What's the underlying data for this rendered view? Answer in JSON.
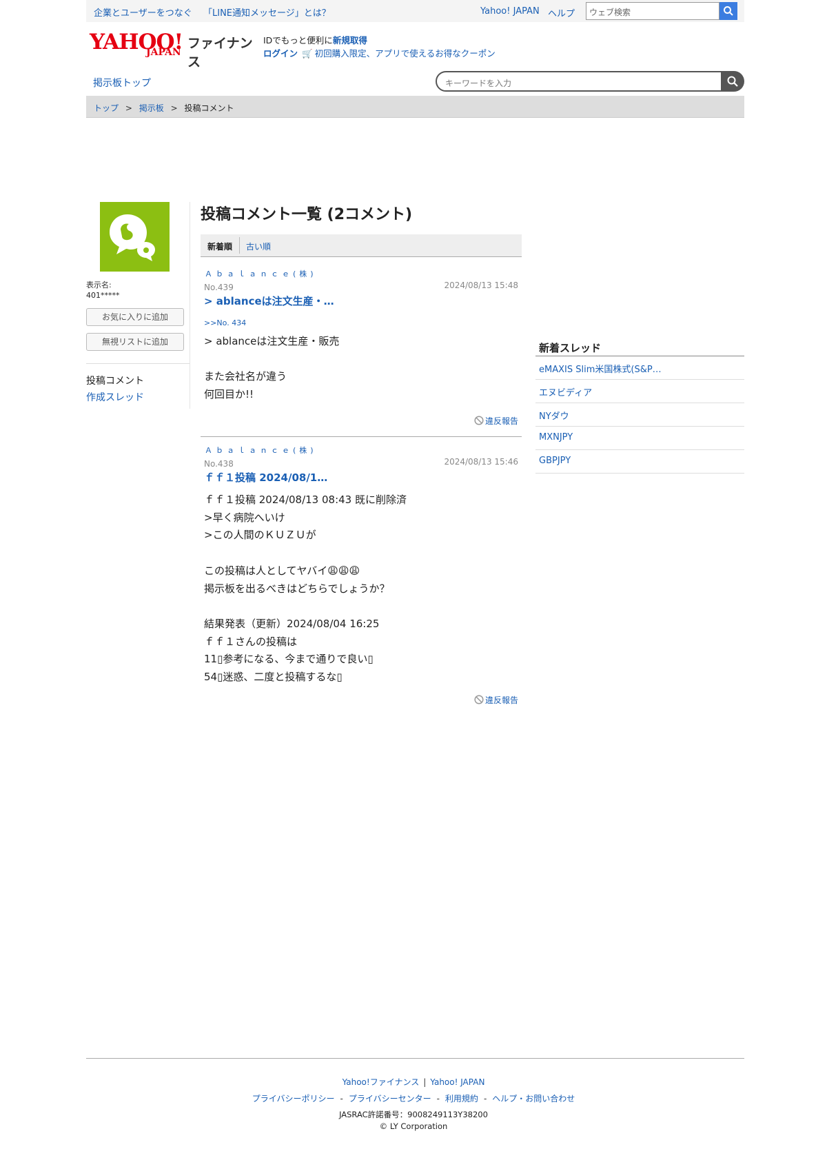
{
  "topbar": {
    "link1": "企業とユーザーをつなぐ",
    "link2": "「LINE通知メッセージ」とは？",
    "yahoo_japan": "Yahoo! JAPAN",
    "help": "ヘルプ",
    "web_search_placeholder": "ウェブ検索"
  },
  "header": {
    "logo_yahoo": "YAHOO!",
    "logo_japan": "JAPAN",
    "logo_finance": "ファイナンス",
    "promo_text": "IDでもっと便利に",
    "promo_signup": "新規取得",
    "login": "ログイン",
    "coupon": "初回購入限定、アプリで使えるお得なクーポン"
  },
  "nav": {
    "board_top": "掲示板トップ",
    "keyword_placeholder": "キーワードを入力"
  },
  "breadcrumb": [
    "トップ",
    "掲示板",
    "投稿コメント"
  ],
  "breadcrumb_sep": ">",
  "profile": {
    "display_name_label": "表示名:",
    "display_name": "401*****",
    "favorite_button": "お気に入りに追加",
    "ignore_button": "無視リストに追加",
    "nav_comments": "投稿コメント",
    "nav_threads": "作成スレッド"
  },
  "main": {
    "heading": "投稿コメント一覧 (2コメント)",
    "sort_newest": "新着順",
    "sort_oldest": "古い順",
    "report_label": "違反報告",
    "posts": [
      {
        "company": "Ａｂａｌａｎｃｅ(株)",
        "number": "No.439",
        "datetime": "2024/08/13 15:48",
        "title": "> ablanceは注文生産・…",
        "reply_to": ">>No. 434",
        "body": "> ablanceは注文生産・販売\n\nまた会社名が違う\n何回目か!!"
      },
      {
        "company": "Ａｂａｌａｎｃｅ(株)",
        "number": "No.438",
        "datetime": "2024/08/13 15:46",
        "title": "ｆｆ１投稿 2024/08/1…",
        "reply_to": "",
        "body": "ｆｆ１投稿 2024/08/13 08:43 既に削除済\n>早く病院へいけ\n>この人間のＫＵＺＵが\n\nこの投稿は人としてヤバイ😩😩😩\n掲示板を出るべきはどちらでしょうか？\n\n結果発表（更新）2024/08/04 16:25\nｆｆ１さんの投稿は\n11▯参考になる、今まで通りで良い▯\n54▯迷惑、二度と投稿するな▯"
      }
    ]
  },
  "sidebar": {
    "heading": "新着スレッド",
    "items": [
      "eMAXIS Slim米国株式(S&P…",
      "エヌビディア",
      "NYダウ",
      "MXNJPY",
      "GBPJPY"
    ]
  },
  "footer": {
    "yahoo_finance": "Yahoo!ファイナンス",
    "divider": "|",
    "yahoo_japan": "Yahoo! JAPAN",
    "privacy_policy": "プライバシーポリシー",
    "privacy_center": "プライバシーセンター",
    "terms": "利用規約",
    "help_contact": "ヘルプ・お問い合わせ",
    "dash": "-",
    "jasrac": "JASRAC許諾番号：9008249113Y38200",
    "copyright": "© LY Corporation"
  },
  "colors": {
    "link": "#1a5fb4",
    "yahoo_red": "#e50012",
    "avatar_green": "#8cbf12",
    "search_blue": "#3b7de0"
  }
}
